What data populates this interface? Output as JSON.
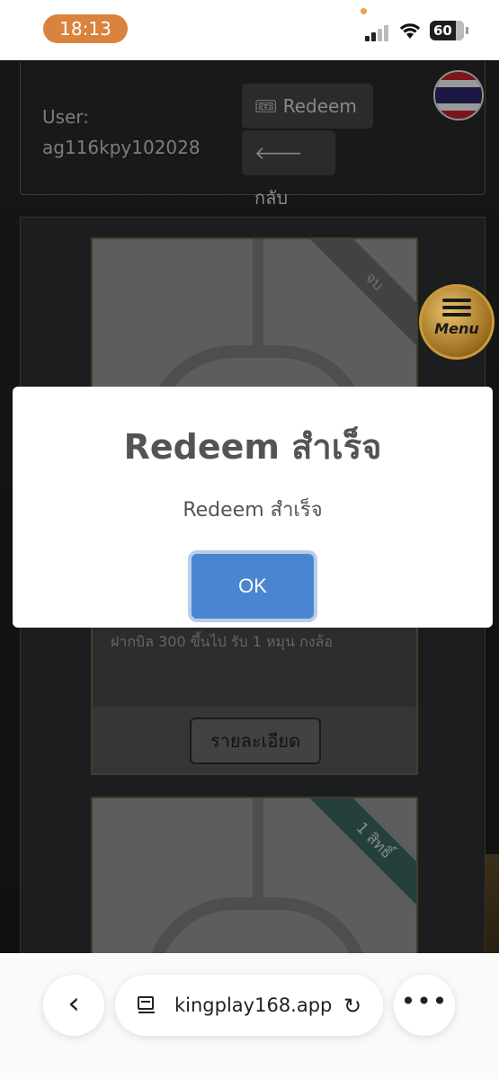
{
  "status_bar": {
    "time": "18:13",
    "battery": "60"
  },
  "site": {
    "user_label": "User:",
    "user_id": "ag116kpy102028",
    "redeem_button": "Redeem",
    "back_button": "กลับ",
    "menu_label": "Menu",
    "card1": {
      "ribbon": "จบ",
      "description": "ฝากบิล 300 ขึ้นไป รับ 1 หมุน กงล้อ",
      "details_button": "รายละเอียด"
    },
    "card2": {
      "ribbon": "1 สิทธิ์"
    }
  },
  "modal": {
    "title": "Redeem สำเร็จ",
    "message": "Redeem สำเร็จ",
    "ok_button": "OK"
  },
  "browser": {
    "url": "kingplay168.app"
  },
  "colors": {
    "accent_blue": "#4a86d0",
    "gold_border": "#7a6235",
    "time_pill": "#d9833d"
  }
}
